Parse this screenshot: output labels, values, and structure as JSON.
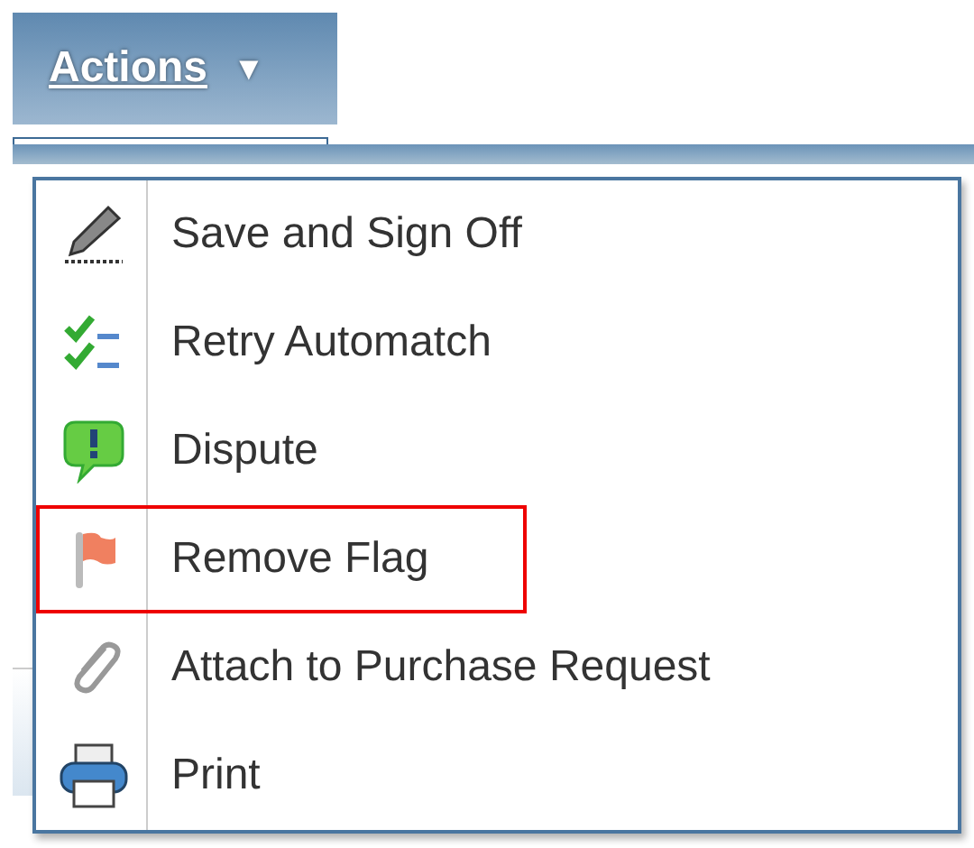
{
  "actions_button": {
    "label": "Actions",
    "caret": "▼"
  },
  "menu": {
    "items": [
      {
        "label": "Save and Sign Off",
        "kind": "pen",
        "highlighted": false
      },
      {
        "label": "Retry Automatch",
        "kind": "checklist",
        "highlighted": false
      },
      {
        "label": "Dispute",
        "kind": "dispute",
        "highlighted": false
      },
      {
        "label": "Remove Flag",
        "kind": "flag",
        "highlighted": true
      },
      {
        "label": "Attach to Purchase Request",
        "kind": "clip",
        "highlighted": false
      },
      {
        "label": "Print",
        "kind": "printer",
        "highlighted": false
      }
    ]
  }
}
